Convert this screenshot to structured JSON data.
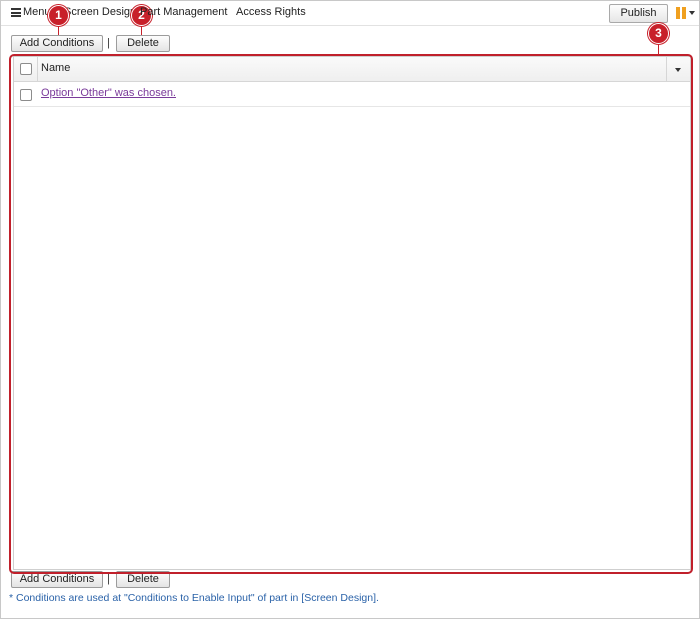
{
  "menu": {
    "items": [
      {
        "label": "Menu"
      },
      {
        "label": "Screen Design"
      },
      {
        "label": "Part Management"
      },
      {
        "label": "Access Rights"
      }
    ],
    "publish_label": "Publish"
  },
  "toolbar_top": {
    "add_label": "Add Conditions",
    "separator": "|",
    "delete_label": "Delete"
  },
  "grid": {
    "header": {
      "name_label": "Name"
    },
    "rows": [
      {
        "name": "Option \"Other\" was chosen."
      }
    ]
  },
  "toolbar_bottom": {
    "add_label": "Add Conditions",
    "separator": "|",
    "delete_label": "Delete"
  },
  "footnote": "* Conditions are used at \"Conditions to Enable Input\" of part in [Screen Design].",
  "callouts": {
    "one": "1",
    "two": "2",
    "three": "3"
  },
  "colors": {
    "accent_red": "#c8202a",
    "link_purple": "#7a3a9a",
    "footnote_blue": "#2a62a8",
    "pause_orange": "#f0a020"
  }
}
